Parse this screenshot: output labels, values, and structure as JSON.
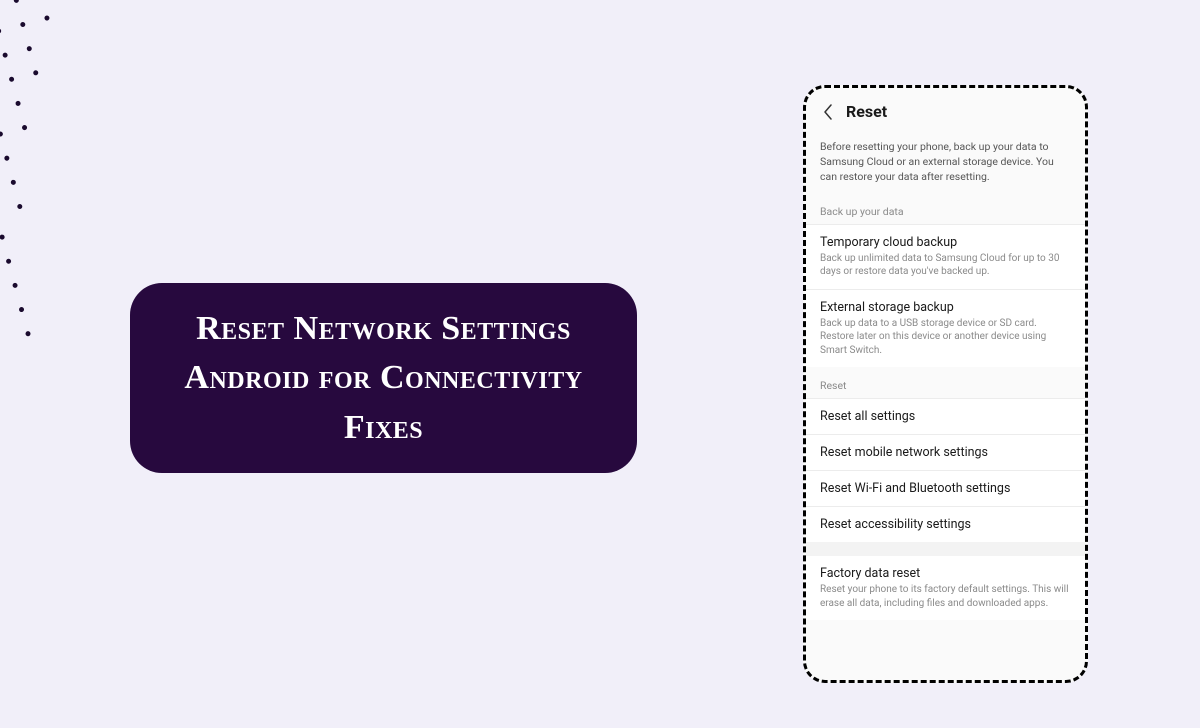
{
  "title_card": {
    "text": "Reset Network Settings Android for Connectivity Fixes"
  },
  "phone": {
    "header": {
      "title": "Reset"
    },
    "intro": "Before resetting your phone, back up your data to Samsung Cloud or an external storage device. You can restore your data after resetting.",
    "sections": {
      "backup": {
        "label": "Back up your data",
        "items": [
          {
            "title": "Temporary cloud backup",
            "desc": "Back up unlimited data to Samsung Cloud for up to 30 days or restore data you've backed up."
          },
          {
            "title": "External storage backup",
            "desc": "Back up data to a USB storage device or SD card. Restore later on this device or another device using Smart Switch."
          }
        ]
      },
      "reset": {
        "label": "Reset",
        "items": [
          {
            "title": "Reset all settings"
          },
          {
            "title": "Reset mobile network settings"
          },
          {
            "title": "Reset Wi-Fi and Bluetooth settings"
          },
          {
            "title": "Reset accessibility settings"
          }
        ]
      },
      "factory": {
        "items": [
          {
            "title": "Factory data reset",
            "desc": "Reset your phone to its factory default settings. This will erase all data, including files and downloaded apps."
          }
        ]
      }
    }
  }
}
